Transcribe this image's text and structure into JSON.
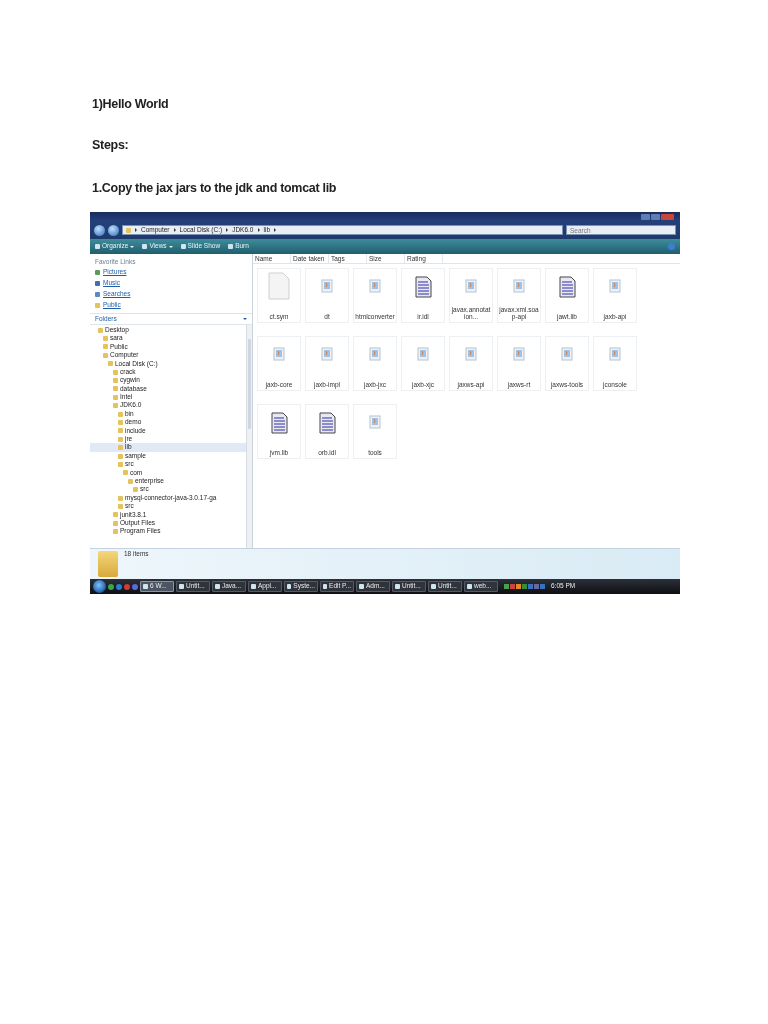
{
  "document": {
    "heading": "1)Hello World",
    "steps_label": "Steps:",
    "step": "1.Copy the jax jars to the jdk and tomcat lib"
  },
  "screenshot": {
    "address_path": [
      "Computer",
      "Local Disk (C:)",
      "JDK6.0",
      "lib"
    ],
    "search": {
      "placeholder": "Search"
    },
    "toolbar": [
      {
        "label": "Organize",
        "dropdown": true
      },
      {
        "label": "Views",
        "dropdown": true
      },
      {
        "label": "Slide Show",
        "dropdown": false
      },
      {
        "label": "Burn",
        "dropdown": false
      }
    ],
    "favorite_links_label": "Favorite Links",
    "favorite_links": [
      "Pictures",
      "Music",
      "Searches",
      "Public"
    ],
    "folders_label": "Folders",
    "folder_tree": [
      {
        "label": "Desktop",
        "selected": false,
        "children": [
          {
            "label": "sara",
            "selected": false
          },
          {
            "label": "Public",
            "selected": false
          },
          {
            "label": "Computer",
            "selected": false,
            "children": [
              {
                "label": "Local Disk (C:)",
                "selected": false,
                "children": [
                  {
                    "label": "crack",
                    "selected": false
                  },
                  {
                    "label": "cygwin",
                    "selected": false
                  },
                  {
                    "label": "database",
                    "selected": false
                  },
                  {
                    "label": "Intel",
                    "selected": false
                  },
                  {
                    "label": "JDK6.0",
                    "selected": false,
                    "children": [
                      {
                        "label": "bin",
                        "selected": false
                      },
                      {
                        "label": "demo",
                        "selected": false
                      },
                      {
                        "label": "include",
                        "selected": false
                      },
                      {
                        "label": "jre",
                        "selected": false
                      },
                      {
                        "label": "lib",
                        "selected": true
                      },
                      {
                        "label": "sample",
                        "selected": false
                      },
                      {
                        "label": "src",
                        "selected": false,
                        "children": [
                          {
                            "label": "com",
                            "selected": false,
                            "children": [
                              {
                                "label": "enterprise",
                                "selected": false,
                                "children": [
                                  {
                                    "label": "src",
                                    "selected": false
                                  }
                                ]
                              }
                            ]
                          }
                        ]
                      },
                      {
                        "label": "mysql-connector-java-3.0.17-ga",
                        "selected": false
                      },
                      {
                        "label": "src",
                        "selected": false
                      }
                    ]
                  },
                  {
                    "label": "junit3.8.1",
                    "selected": false
                  },
                  {
                    "label": "Output Files",
                    "selected": false
                  },
                  {
                    "label": "Program Files",
                    "selected": false
                  }
                ]
              }
            ]
          }
        ]
      }
    ],
    "columns": [
      "Name",
      "Date taken",
      "Tags",
      "Size",
      "Rating"
    ],
    "files": [
      {
        "name": "ct.sym",
        "kind": "blank"
      },
      {
        "name": "dt",
        "kind": "jar"
      },
      {
        "name": "htmlconverter",
        "kind": "jar"
      },
      {
        "name": "ir.idl",
        "kind": "text"
      },
      {
        "name": "javax.annotation...",
        "kind": "jar"
      },
      {
        "name": "javax.xml.soap-api",
        "kind": "jar"
      },
      {
        "name": "jawt.lib",
        "kind": "text"
      },
      {
        "name": "jaxb-api",
        "kind": "jar"
      },
      {
        "name": "jaxb-core",
        "kind": "jar"
      },
      {
        "name": "jaxb-impl",
        "kind": "jar"
      },
      {
        "name": "jaxb-jxc",
        "kind": "jar"
      },
      {
        "name": "jaxb-xjc",
        "kind": "jar"
      },
      {
        "name": "jaxws-api",
        "kind": "jar"
      },
      {
        "name": "jaxws-rt",
        "kind": "jar"
      },
      {
        "name": "jaxws-tools",
        "kind": "jar"
      },
      {
        "name": "jconsole",
        "kind": "jar"
      },
      {
        "name": "jvm.lib",
        "kind": "text"
      },
      {
        "name": "orb.idl",
        "kind": "text"
      },
      {
        "name": "tools",
        "kind": "jar"
      }
    ],
    "details": "18 items",
    "taskbar": {
      "buttons": [
        {
          "label": "6 W...",
          "selected": true
        },
        {
          "label": "Untit...",
          "selected": false
        },
        {
          "label": "Java...",
          "selected": false
        },
        {
          "label": "Appl...",
          "selected": false
        },
        {
          "label": "Syste...",
          "selected": false
        },
        {
          "label": "Edit P...",
          "selected": false
        },
        {
          "label": "Adm...",
          "selected": false
        },
        {
          "label": "Untit...",
          "selected": false
        },
        {
          "label": "Untit...",
          "selected": false
        },
        {
          "label": "web...",
          "selected": false
        }
      ],
      "clock": "6:05 PM"
    }
  }
}
